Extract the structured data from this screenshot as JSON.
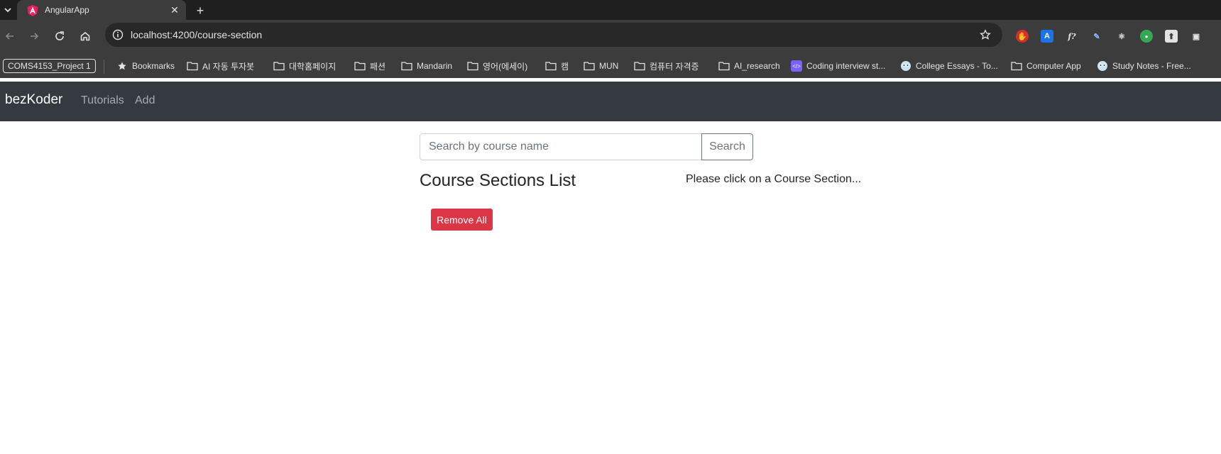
{
  "browser": {
    "tab": {
      "title": "AngularApp"
    },
    "url": "localhost:4200/course-section",
    "bookmarks": [
      {
        "label": "COMS4153_Project 1",
        "type": "pill"
      },
      {
        "label": "Bookmarks",
        "icon": "star-icon"
      },
      {
        "label": "AI 자동 투자봇",
        "icon": "folder-icon"
      },
      {
        "label": "대학홈페이지",
        "icon": "folder-icon"
      },
      {
        "label": "패션",
        "icon": "folder-icon"
      },
      {
        "label": "Mandarin",
        "icon": "folder-icon"
      },
      {
        "label": "영어(에세이)",
        "icon": "folder-icon"
      },
      {
        "label": "캠",
        "icon": "folder-icon"
      },
      {
        "label": "MUN",
        "icon": "folder-icon"
      },
      {
        "label": "컴퓨터 자격증",
        "icon": "folder-icon"
      },
      {
        "label": "AI_research",
        "icon": "folder-icon"
      },
      {
        "label": "Coding interview st...",
        "icon": "code-icon"
      },
      {
        "label": "College Essays - To...",
        "icon": "owl-icon"
      },
      {
        "label": "Computer App",
        "icon": "folder-icon"
      },
      {
        "label": "Study Notes - Free...",
        "icon": "owl-icon"
      }
    ]
  },
  "navbar": {
    "brand": "bezKoder",
    "links": [
      "Tutorials",
      "Add"
    ]
  },
  "search": {
    "placeholder": "Search by course name",
    "button_label": "Search"
  },
  "list": {
    "title": "Course Sections List",
    "remove_all_label": "Remove All"
  },
  "detail": {
    "hint": "Please click on a Course Section..."
  },
  "colors": {
    "navbar_bg": "#343a40",
    "danger": "#dc3545",
    "secondary": "#6c757d"
  }
}
